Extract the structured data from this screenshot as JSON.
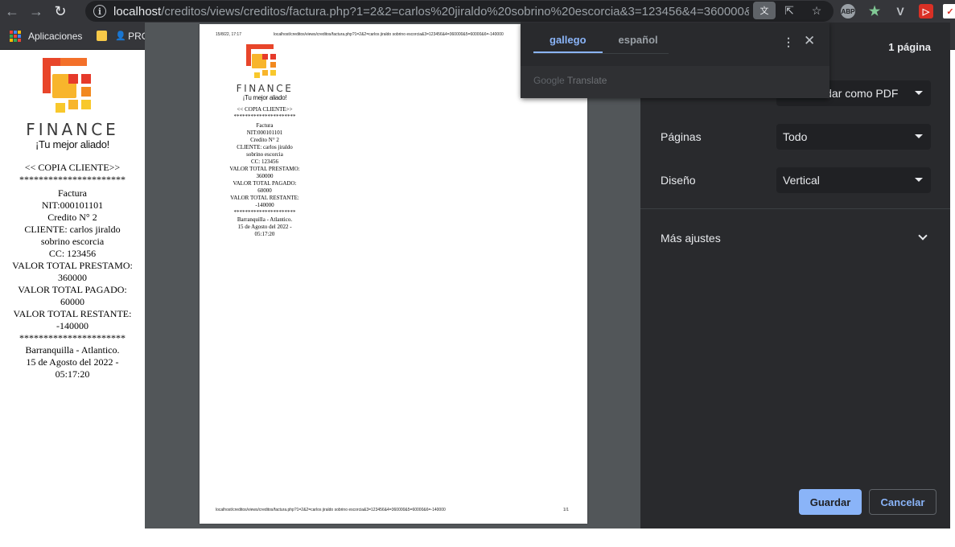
{
  "browser": {
    "url_host": "localhost",
    "url_rest": "/creditos/views/creditos/factura.php?1=2&2=carlos%20jiraldo%20sobrino%20escorcia&3=123456&4=360000&5=60..."
  },
  "bookmarks": {
    "apps_label": "Aplicaciones",
    "item2_label": "PRO"
  },
  "logo": {
    "word": "FINANCE",
    "tagline": "¡Tu mejor aliado!"
  },
  "receipt": {
    "copy": "<< COPIA CLIENTE>>",
    "stars": "**********************",
    "doc": "Factura",
    "nit": "NIT:000101101",
    "credito": "Credito N° 2",
    "cliente_1": "CLIENTE: carlos jiraldo",
    "cliente_2": "sobrino escorcia",
    "cc": "CC: 123456",
    "prestamo_label": "VALOR TOTAL PRESTAMO:",
    "prestamo_value": "360000",
    "pagado_label": "VALOR TOTAL PAGADO:",
    "pagado_value": "60000",
    "restante_label": "VALOR TOTAL RESTANTE:",
    "restante_value": "-140000",
    "city": "Barranquilla - Atlantico.",
    "date_1": "15 de Agosto del 2022 -",
    "date_2": "05:17:20"
  },
  "print_preview": {
    "header_date": "15/8/22, 17:17",
    "header_url": "localhost/creditos/views/creditos/factura.php?1=2&2=carlos jiraldo sobrino escorcia&3=123456&4=360000&5=60000&6=-140000",
    "footer_url": "localhost/creditos/views/creditos/factura.php?1=2&2=carlos jiraldo sobrino escorcia&3=123456&4=360000&5=60000&6=-140000",
    "page_number": "1/1",
    "pages_count": "1 página",
    "destination_value": "Guardar como PDF",
    "pages_label": "Páginas",
    "pages_value": "Todo",
    "layout_label": "Diseño",
    "layout_value": "Vertical",
    "more_settings": "Más ajustes",
    "save_label": "Guardar",
    "cancel_label": "Cancelar"
  },
  "translate": {
    "tab_source": "gallego",
    "tab_target": "español",
    "brand_google": "Google",
    "brand_translate": "Translate"
  }
}
